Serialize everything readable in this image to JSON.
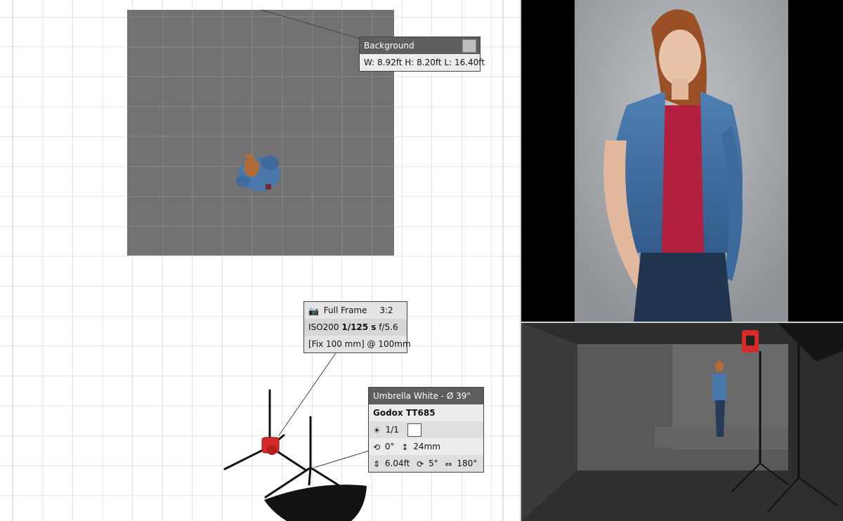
{
  "background_tooltip": {
    "title": "Background",
    "dimensions": "W: 8.92ft H: 8.20ft L: 16.40ft",
    "swatch_color": "#bdbdbd"
  },
  "camera_tooltip": {
    "sensor": "Full Frame",
    "ratio": "3:2",
    "iso": "ISO200",
    "shutter": "1/125 s",
    "aperture": "f/5.6",
    "lens": "[Fix 100 mm] @ 100mm"
  },
  "light_tooltip": {
    "modifier": "Umbrella White - Ø 39\"",
    "flash": "Godox TT685",
    "power": "1/1",
    "tilt": "0°",
    "height_offset": "24mm",
    "height": "6.04ft",
    "rotation_angle": "5°",
    "spread_angle": "180°"
  },
  "colors": {
    "canvas_bg": "#ffffff",
    "grid_line": "#c9c9c9",
    "backdrop": "#6d6d6d",
    "tooltip_head": "#5e5e5e",
    "tooltip_row": "#ececec",
    "flash_red": "#d42a2a"
  }
}
